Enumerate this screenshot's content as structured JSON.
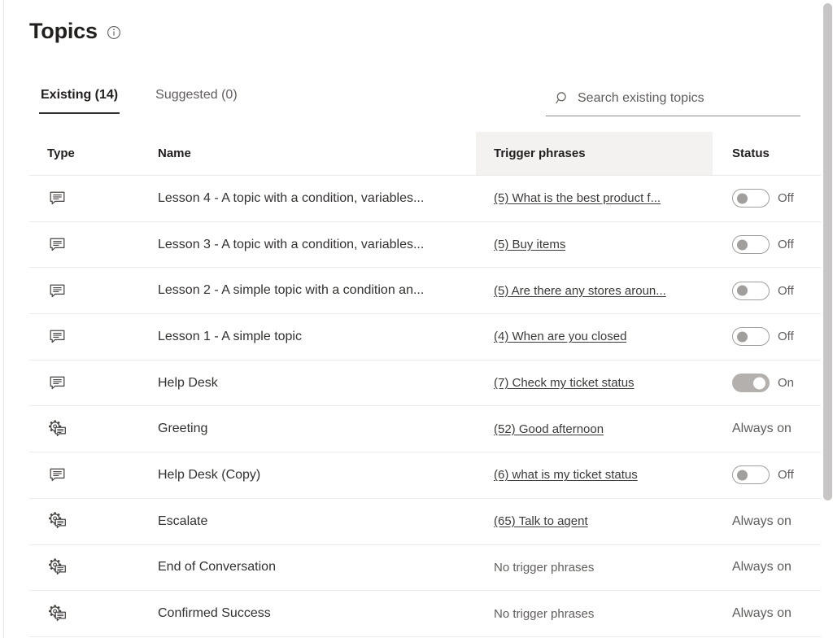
{
  "header": {
    "title": "Topics",
    "info_icon": "info-circle-icon"
  },
  "tabs": [
    {
      "label": "Existing (14)",
      "active": true
    },
    {
      "label": "Suggested (0)",
      "active": false
    }
  ],
  "search": {
    "icon": "search-icon",
    "placeholder": "Search existing topics",
    "value": ""
  },
  "table": {
    "columns": [
      {
        "key": "type",
        "label": "Type"
      },
      {
        "key": "name",
        "label": "Name"
      },
      {
        "key": "trigger",
        "label": "Trigger phrases",
        "highlighted": true
      },
      {
        "key": "status",
        "label": "Status"
      }
    ],
    "rows": [
      {
        "type_icon": "chat-bubble-icon",
        "name": "Lesson 4 - A topic with a condition, variables...",
        "trigger": "(5) What is the best product f...",
        "trigger_link": true,
        "status_kind": "toggle",
        "status_on": false,
        "status_label": "Off"
      },
      {
        "type_icon": "chat-bubble-icon",
        "name": "Lesson 3 - A topic with a condition, variables...",
        "trigger": "(5) Buy items",
        "trigger_link": true,
        "status_kind": "toggle",
        "status_on": false,
        "status_label": "Off"
      },
      {
        "type_icon": "chat-bubble-icon",
        "name": "Lesson 2 - A simple topic with a condition an...",
        "trigger": "(5) Are there any stores aroun...",
        "trigger_link": true,
        "status_kind": "toggle",
        "status_on": false,
        "status_label": "Off"
      },
      {
        "type_icon": "chat-bubble-icon",
        "name": "Lesson 1 - A simple topic",
        "trigger": "(4) When are you closed",
        "trigger_link": true,
        "status_kind": "toggle",
        "status_on": false,
        "status_label": "Off"
      },
      {
        "type_icon": "chat-bubble-icon",
        "name": "Help Desk",
        "trigger": "(7) Check my ticket status",
        "trigger_link": true,
        "status_kind": "toggle",
        "status_on": true,
        "status_label": "On"
      },
      {
        "type_icon": "system-topic-icon",
        "name": "Greeting",
        "trigger": "(52) Good afternoon",
        "trigger_link": true,
        "status_kind": "text",
        "status_on": true,
        "status_label": "Always on"
      },
      {
        "type_icon": "chat-bubble-icon",
        "name": "Help Desk (Copy)",
        "trigger": "(6) what is my ticket status",
        "trigger_link": true,
        "status_kind": "toggle",
        "status_on": false,
        "status_label": "Off"
      },
      {
        "type_icon": "system-topic-icon",
        "name": "Escalate",
        "trigger": "(65) Talk to agent",
        "trigger_link": true,
        "status_kind": "text",
        "status_on": true,
        "status_label": "Always on"
      },
      {
        "type_icon": "system-topic-icon",
        "name": "End of Conversation",
        "trigger": "No trigger phrases",
        "trigger_link": false,
        "status_kind": "text",
        "status_on": true,
        "status_label": "Always on"
      },
      {
        "type_icon": "system-topic-icon",
        "name": "Confirmed Success",
        "trigger": "No trigger phrases",
        "trigger_link": false,
        "status_kind": "text",
        "status_on": true,
        "status_label": "Always on"
      }
    ]
  },
  "scrollbar": {
    "name": "vertical-scrollbar"
  },
  "colors": {
    "text_primary": "#201f1e",
    "text_secondary": "#605e5c",
    "divider": "#edebe9",
    "header_highlight": "#f3f2f1",
    "toggle_on": "#b3b0ad",
    "scrollbar_thumb": "#c8c6c4"
  }
}
